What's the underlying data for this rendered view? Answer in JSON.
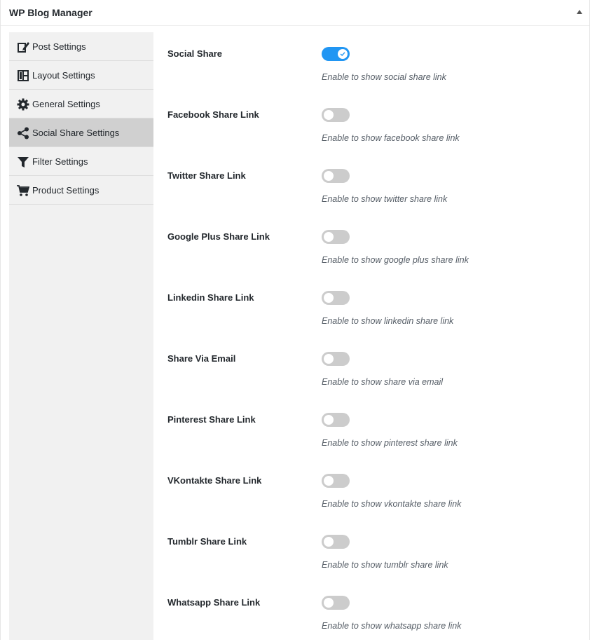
{
  "panel": {
    "title": "WP Blog Manager"
  },
  "sidebar": {
    "items": [
      {
        "label": "Post Settings",
        "icon": "edit-icon",
        "active": false
      },
      {
        "label": "Layout Settings",
        "icon": "layout-icon",
        "active": false
      },
      {
        "label": "General Settings",
        "icon": "gear-icon",
        "active": false
      },
      {
        "label": "Social Share Settings",
        "icon": "share-icon",
        "active": true
      },
      {
        "label": "Filter Settings",
        "icon": "filter-icon",
        "active": false
      },
      {
        "label": "Product Settings",
        "icon": "cart-icon",
        "active": false
      }
    ]
  },
  "settings": [
    {
      "label": "Social Share",
      "description": "Enable to show social share link",
      "enabled": true
    },
    {
      "label": "Facebook Share Link",
      "description": "Enable to show facebook share link",
      "enabled": false
    },
    {
      "label": "Twitter Share Link",
      "description": "Enable to show twitter share link",
      "enabled": false
    },
    {
      "label": "Google Plus Share Link",
      "description": "Enable to show google plus share link",
      "enabled": false
    },
    {
      "label": "Linkedin Share Link",
      "description": "Enable to show linkedin share link",
      "enabled": false
    },
    {
      "label": "Share Via Email",
      "description": "Enable to show share via email",
      "enabled": false
    },
    {
      "label": "Pinterest Share Link",
      "description": "Enable to show pinterest share link",
      "enabled": false
    },
    {
      "label": "VKontakte Share Link",
      "description": "Enable to show vkontakte share link",
      "enabled": false
    },
    {
      "label": "Tumblr Share Link",
      "description": "Enable to show tumblr share link",
      "enabled": false
    },
    {
      "label": "Whatsapp Share Link",
      "description": "Enable to show whatsapp share link",
      "enabled": false
    }
  ],
  "colors": {
    "toggle_on": "#2196f3",
    "toggle_off": "#cccccc",
    "active_nav": "#d0d0d0",
    "sidebar_bg": "#f1f1f1"
  }
}
